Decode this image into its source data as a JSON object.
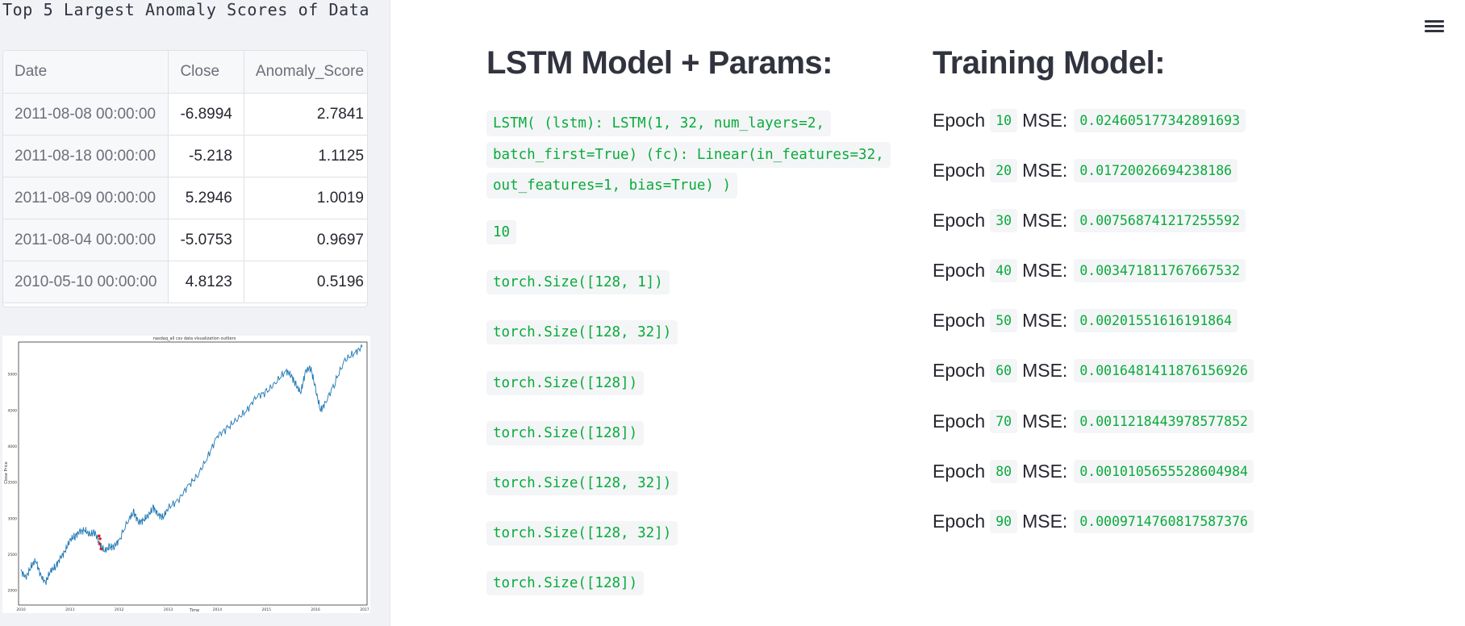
{
  "sidebar": {
    "title": "Top 5 Largest Anomaly Scores of Data",
    "table": {
      "columns": [
        "Date",
        "Close",
        "Anomaly_Score"
      ],
      "rows": [
        {
          "date": "2011-08-08 00:00:00",
          "close": "-6.8994",
          "score": "2.7841"
        },
        {
          "date": "2011-08-18 00:00:00",
          "close": "-5.218",
          "score": "1.1125"
        },
        {
          "date": "2011-08-09 00:00:00",
          "close": "5.2946",
          "score": "1.0019"
        },
        {
          "date": "2011-08-04 00:00:00",
          "close": "-5.0753",
          "score": "0.9697"
        },
        {
          "date": "2010-05-10 00:00:00",
          "close": "4.8123",
          "score": "0.5196"
        }
      ]
    }
  },
  "chart_data": {
    "type": "line",
    "title": "nasdaq_all csv data visualization outliers",
    "xlabel": "Time",
    "ylabel": "Close Price",
    "x_ticks": [
      "2010",
      "2011",
      "2012",
      "2013",
      "2014",
      "2015",
      "2016",
      "2017"
    ],
    "y_ticks": [
      "2000",
      "2500",
      "3000",
      "3500",
      "4000",
      "4500",
      "5000"
    ],
    "ylim": [
      2000,
      5300
    ],
    "series": [
      {
        "color": "#1f77b4",
        "x": [
          2010.0,
          2010.1,
          2010.2,
          2010.3,
          2010.4,
          2010.5,
          2010.6,
          2010.7,
          2010.8,
          2010.9,
          2011.0,
          2011.1,
          2011.2,
          2011.3,
          2011.4,
          2011.5,
          2011.6,
          2011.7,
          2011.8,
          2011.9,
          2012.0,
          2012.2,
          2012.3,
          2012.4,
          2012.5,
          2012.6,
          2012.7,
          2012.8,
          2012.9,
          2013.0,
          2013.2,
          2013.4,
          2013.6,
          2013.8,
          2014.0,
          2014.2,
          2014.4,
          2014.6,
          2014.8,
          2015.0,
          2015.2,
          2015.4,
          2015.5,
          2015.6,
          2015.7,
          2015.8,
          2015.9,
          2016.0,
          2016.1,
          2016.2,
          2016.4,
          2016.6,
          2016.8,
          2016.95
        ],
        "y": [
          2270,
          2180,
          2330,
          2420,
          2210,
          2110,
          2270,
          2330,
          2450,
          2550,
          2700,
          2760,
          2820,
          2840,
          2770,
          2820,
          2650,
          2550,
          2600,
          2620,
          2700,
          3000,
          3080,
          2950,
          2980,
          3050,
          3150,
          3050,
          3020,
          3150,
          3250,
          3450,
          3600,
          3850,
          4150,
          4250,
          4380,
          4500,
          4700,
          4750,
          4900,
          5050,
          5000,
          4850,
          4750,
          5050,
          5100,
          4800,
          4500,
          4600,
          4900,
          5200,
          5300,
          5380
        ]
      }
    ],
    "outliers": [
      {
        "x": 2011.6,
        "y": 2650
      },
      {
        "x": 2011.63,
        "y": 2580
      },
      {
        "x": 2011.61,
        "y": 2720
      },
      {
        "x": 2011.59,
        "y": 2760
      }
    ]
  },
  "main": {
    "menu_icon": "hamburger-menu-icon",
    "lstm": {
      "title": "LSTM Model + Params:",
      "model_text": "LSTM( (lstm): LSTM(1, 32, num_layers=2, batch_first=True) (fc): Linear(in_features=32, out_features=1, bias=True) )",
      "outputs": [
        "10",
        "torch.Size([128, 1])",
        "torch.Size([128, 32])",
        "torch.Size([128])",
        "torch.Size([128])",
        "torch.Size([128, 32])",
        "torch.Size([128, 32])",
        "torch.Size([128])"
      ]
    },
    "training": {
      "title": "Training Model:",
      "epoch_word": "Epoch",
      "mse_word": "MSE:",
      "epochs": [
        {
          "n": "10",
          "mse": "0.024605177342891693"
        },
        {
          "n": "20",
          "mse": "0.01720026694238186"
        },
        {
          "n": "30",
          "mse": "0.007568741217255592"
        },
        {
          "n": "40",
          "mse": "0.003471811767667532"
        },
        {
          "n": "50",
          "mse": "0.00201551616191864"
        },
        {
          "n": "60",
          "mse": "0.0016481411876156926"
        },
        {
          "n": "70",
          "mse": "0.0011218443978577852"
        },
        {
          "n": "80",
          "mse": "0.0010105655528604984"
        },
        {
          "n": "90",
          "mse": "0.0009714760817587376"
        }
      ]
    }
  }
}
